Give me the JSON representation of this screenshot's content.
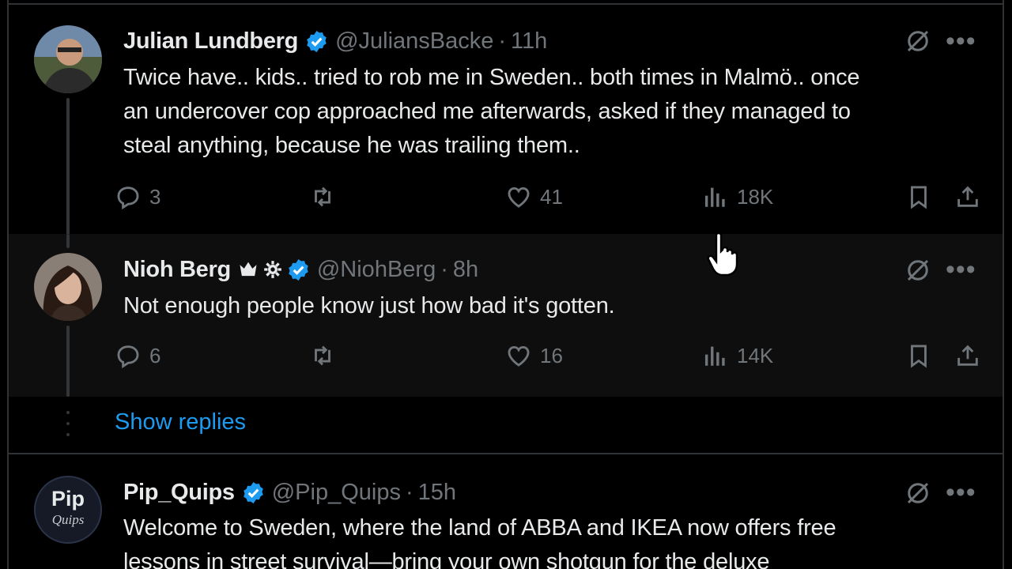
{
  "posts": [
    {
      "name": "Julian Lundberg",
      "handle": "@JuliansBacke",
      "time": "11h",
      "lines": [
        "Twice have.. kids.. tried to rob me in Sweden.. both times in Malmö.. once",
        "an undercover cop approached me afterwards, asked if they managed to",
        "steal anything, because he was trailing them.."
      ],
      "replies": "3",
      "reposts": "",
      "likes": "41",
      "views": "18K"
    },
    {
      "name": "Nioh Berg",
      "handle": "@NiohBerg",
      "time": "8h",
      "lines": [
        "Not enough people know just how bad it's gotten."
      ],
      "replies": "6",
      "reposts": "",
      "likes": "16",
      "views": "14K"
    },
    {
      "name": "Pip_Quips",
      "handle": "@Pip_Quips",
      "time": "15h",
      "lines": [
        "Welcome to Sweden, where the land of ABBA and IKEA now offers free",
        "lessons in street survival—bring your own shotgun for the deluxe"
      ],
      "avatar_text": [
        "Pip",
        "Quips"
      ]
    }
  ],
  "show_replies": "Show replies",
  "separator": "·",
  "colors": {
    "accent": "#1d9bf0",
    "muted": "#71767b",
    "text": "#e7e9ea",
    "background": "#000000"
  },
  "icons": [
    "reply-icon",
    "repost-icon",
    "like-icon",
    "views-icon",
    "bookmark-icon",
    "share-icon",
    "grok-icon",
    "more-icon",
    "verified-badge",
    "crown-icon",
    "gear-icon",
    "pointer-cursor"
  ]
}
